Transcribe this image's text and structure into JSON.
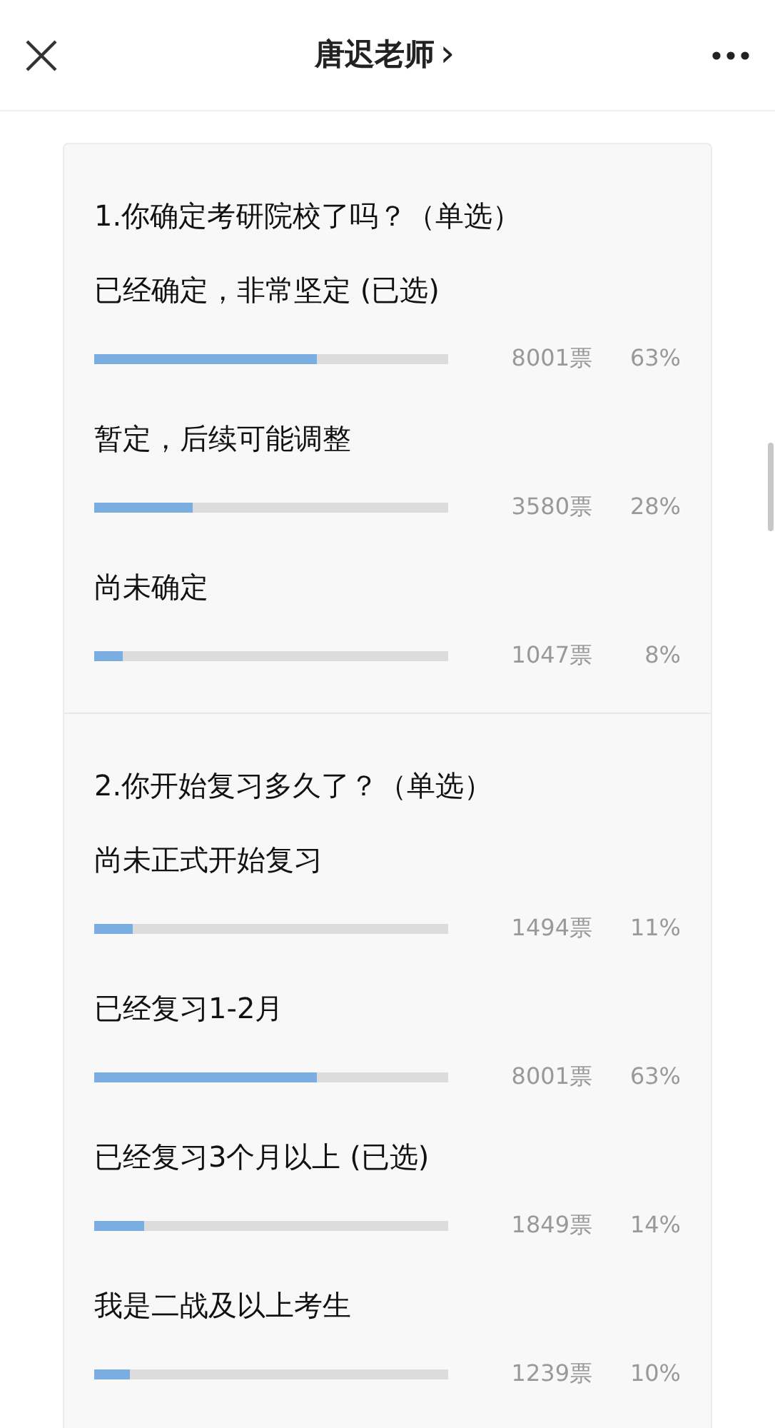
{
  "header": {
    "title": "唐迟老师",
    "chevron": "›"
  },
  "questions": [
    {
      "title": "1.你确定考研院校了吗？（单选）",
      "options": [
        {
          "label": "已经确定，非常坚定 (已选)",
          "level": 0.63,
          "votes": "8001票",
          "percent": "63%"
        },
        {
          "label": "暂定，后续可能调整",
          "level": 0.28,
          "votes": "3580票",
          "percent": "28%"
        },
        {
          "label": "尚未确定",
          "level": 0.08,
          "votes": "1047票",
          "percent": "8%"
        }
      ]
    },
    {
      "title": "2.你开始复习多久了？（单选）",
      "options": [
        {
          "label": "尚未正式开始复习",
          "level": 0.11,
          "votes": "1494票",
          "percent": "11%"
        },
        {
          "label": "已经复习1-2月",
          "level": 0.63,
          "votes": "8001票",
          "percent": "63%"
        },
        {
          "label": "已经复习3个月以上 (已选)",
          "level": 0.14,
          "votes": "1849票",
          "percent": "14%"
        },
        {
          "label": "我是二战及以上考生",
          "level": 0.1,
          "votes": "1239票",
          "percent": "10%"
        }
      ]
    }
  ]
}
